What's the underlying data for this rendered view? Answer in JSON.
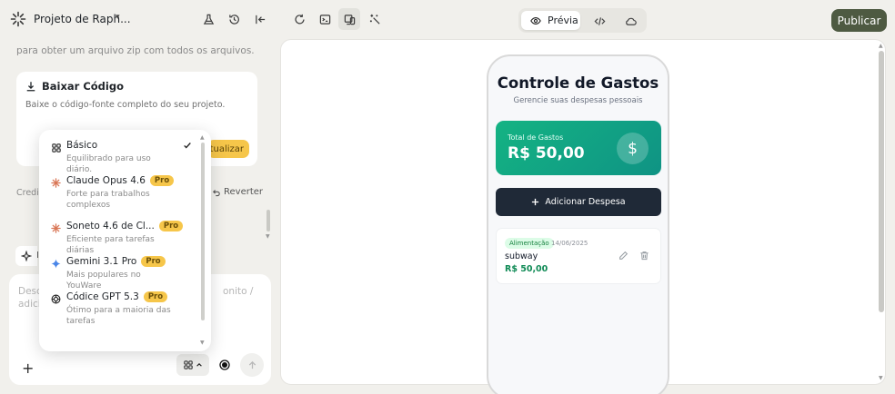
{
  "header": {
    "project_title": "Projeto de Raph...",
    "preview_label": "Prévia",
    "publish_label": "Publicar"
  },
  "left": {
    "top_text": "para obter um arquivo zip com todos os arquivos.",
    "download_card": {
      "title": "Baixar Código",
      "description": "Baixe o código-fonte completo do seu projeto.",
      "button_partial": "Atualizar"
    },
    "credit_partial": "Credit",
    "revert_label": "Reverter",
    "chip_letter": "I",
    "chat": {
      "placeholder_left": "Desc",
      "placeholder_right": "onito /",
      "placeholder_line2": "adici"
    }
  },
  "model_menu": {
    "items": [
      {
        "name": "Básico",
        "description": "Equilibrado para uso diário.",
        "pro": "",
        "selected": true,
        "icon": "grid-icon"
      },
      {
        "name": "Claude Opus 4.6",
        "description": "Forte para trabalhos complexos",
        "pro": "Pro",
        "selected": false,
        "icon": "claude-icon"
      },
      {
        "name": "Soneto 4.6 de Cl...",
        "description": "Eficiente para tarefas diárias",
        "pro": "Pro",
        "selected": false,
        "icon": "claude-icon"
      },
      {
        "name": "Gemini 3.1 Pro",
        "description": "Mais populares no YouWare",
        "pro": "Pro",
        "selected": false,
        "icon": "gemini-icon"
      },
      {
        "name": "Códice GPT 5.3",
        "description": "Ótimo para a maioria das tarefas",
        "pro": "Pro",
        "selected": false,
        "icon": "openai-icon"
      }
    ]
  },
  "preview": {
    "app_title": "Controle de Gastos",
    "app_subtitle": "Gerencie suas despesas pessoais",
    "total_label": "Total de Gastos",
    "total_value": "R$ 50,00",
    "dollar_symbol": "$",
    "add_button": "Adicionar Despesa",
    "expense": {
      "category": "Alimentação",
      "date": "14/06/2025",
      "name": "subway",
      "amount": "R$ 50,00"
    }
  },
  "colors": {
    "publish": "#4e5a42",
    "pro_badge": "#f6c64a",
    "total_card_start": "#14b383",
    "total_card_end": "#0f9384",
    "add_button": "#1f2937",
    "amount_green": "#0f8a55"
  }
}
